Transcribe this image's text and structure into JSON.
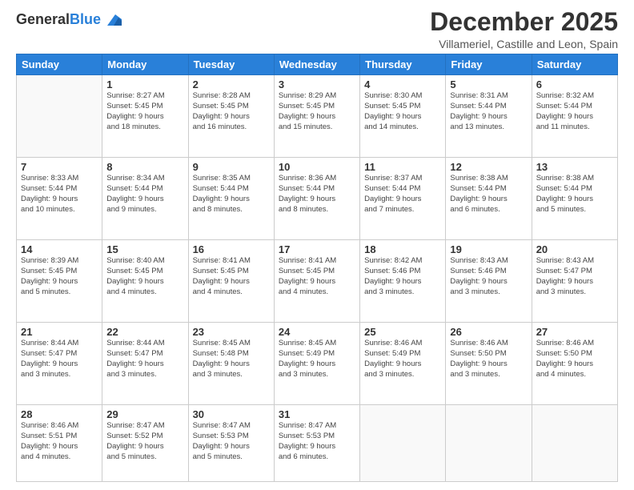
{
  "header": {
    "logo": {
      "general": "General",
      "blue": "Blue"
    },
    "title": "December 2025",
    "subtitle": "Villameriel, Castille and Leon, Spain"
  },
  "calendar": {
    "days_of_week": [
      "Sunday",
      "Monday",
      "Tuesday",
      "Wednesday",
      "Thursday",
      "Friday",
      "Saturday"
    ],
    "weeks": [
      [
        {
          "day": "",
          "info": ""
        },
        {
          "day": "1",
          "info": "Sunrise: 8:27 AM\nSunset: 5:45 PM\nDaylight: 9 hours\nand 18 minutes."
        },
        {
          "day": "2",
          "info": "Sunrise: 8:28 AM\nSunset: 5:45 PM\nDaylight: 9 hours\nand 16 minutes."
        },
        {
          "day": "3",
          "info": "Sunrise: 8:29 AM\nSunset: 5:45 PM\nDaylight: 9 hours\nand 15 minutes."
        },
        {
          "day": "4",
          "info": "Sunrise: 8:30 AM\nSunset: 5:45 PM\nDaylight: 9 hours\nand 14 minutes."
        },
        {
          "day": "5",
          "info": "Sunrise: 8:31 AM\nSunset: 5:44 PM\nDaylight: 9 hours\nand 13 minutes."
        },
        {
          "day": "6",
          "info": "Sunrise: 8:32 AM\nSunset: 5:44 PM\nDaylight: 9 hours\nand 11 minutes."
        }
      ],
      [
        {
          "day": "7",
          "info": "Sunrise: 8:33 AM\nSunset: 5:44 PM\nDaylight: 9 hours\nand 10 minutes."
        },
        {
          "day": "8",
          "info": "Sunrise: 8:34 AM\nSunset: 5:44 PM\nDaylight: 9 hours\nand 9 minutes."
        },
        {
          "day": "9",
          "info": "Sunrise: 8:35 AM\nSunset: 5:44 PM\nDaylight: 9 hours\nand 8 minutes."
        },
        {
          "day": "10",
          "info": "Sunrise: 8:36 AM\nSunset: 5:44 PM\nDaylight: 9 hours\nand 8 minutes."
        },
        {
          "day": "11",
          "info": "Sunrise: 8:37 AM\nSunset: 5:44 PM\nDaylight: 9 hours\nand 7 minutes."
        },
        {
          "day": "12",
          "info": "Sunrise: 8:38 AM\nSunset: 5:44 PM\nDaylight: 9 hours\nand 6 minutes."
        },
        {
          "day": "13",
          "info": "Sunrise: 8:38 AM\nSunset: 5:44 PM\nDaylight: 9 hours\nand 5 minutes."
        }
      ],
      [
        {
          "day": "14",
          "info": "Sunrise: 8:39 AM\nSunset: 5:45 PM\nDaylight: 9 hours\nand 5 minutes."
        },
        {
          "day": "15",
          "info": "Sunrise: 8:40 AM\nSunset: 5:45 PM\nDaylight: 9 hours\nand 4 minutes."
        },
        {
          "day": "16",
          "info": "Sunrise: 8:41 AM\nSunset: 5:45 PM\nDaylight: 9 hours\nand 4 minutes."
        },
        {
          "day": "17",
          "info": "Sunrise: 8:41 AM\nSunset: 5:45 PM\nDaylight: 9 hours\nand 4 minutes."
        },
        {
          "day": "18",
          "info": "Sunrise: 8:42 AM\nSunset: 5:46 PM\nDaylight: 9 hours\nand 3 minutes."
        },
        {
          "day": "19",
          "info": "Sunrise: 8:43 AM\nSunset: 5:46 PM\nDaylight: 9 hours\nand 3 minutes."
        },
        {
          "day": "20",
          "info": "Sunrise: 8:43 AM\nSunset: 5:47 PM\nDaylight: 9 hours\nand 3 minutes."
        }
      ],
      [
        {
          "day": "21",
          "info": "Sunrise: 8:44 AM\nSunset: 5:47 PM\nDaylight: 9 hours\nand 3 minutes."
        },
        {
          "day": "22",
          "info": "Sunrise: 8:44 AM\nSunset: 5:47 PM\nDaylight: 9 hours\nand 3 minutes."
        },
        {
          "day": "23",
          "info": "Sunrise: 8:45 AM\nSunset: 5:48 PM\nDaylight: 9 hours\nand 3 minutes."
        },
        {
          "day": "24",
          "info": "Sunrise: 8:45 AM\nSunset: 5:49 PM\nDaylight: 9 hours\nand 3 minutes."
        },
        {
          "day": "25",
          "info": "Sunrise: 8:46 AM\nSunset: 5:49 PM\nDaylight: 9 hours\nand 3 minutes."
        },
        {
          "day": "26",
          "info": "Sunrise: 8:46 AM\nSunset: 5:50 PM\nDaylight: 9 hours\nand 3 minutes."
        },
        {
          "day": "27",
          "info": "Sunrise: 8:46 AM\nSunset: 5:50 PM\nDaylight: 9 hours\nand 4 minutes."
        }
      ],
      [
        {
          "day": "28",
          "info": "Sunrise: 8:46 AM\nSunset: 5:51 PM\nDaylight: 9 hours\nand 4 minutes."
        },
        {
          "day": "29",
          "info": "Sunrise: 8:47 AM\nSunset: 5:52 PM\nDaylight: 9 hours\nand 5 minutes."
        },
        {
          "day": "30",
          "info": "Sunrise: 8:47 AM\nSunset: 5:53 PM\nDaylight: 9 hours\nand 5 minutes."
        },
        {
          "day": "31",
          "info": "Sunrise: 8:47 AM\nSunset: 5:53 PM\nDaylight: 9 hours\nand 6 minutes."
        },
        {
          "day": "",
          "info": ""
        },
        {
          "day": "",
          "info": ""
        },
        {
          "day": "",
          "info": ""
        }
      ]
    ]
  }
}
